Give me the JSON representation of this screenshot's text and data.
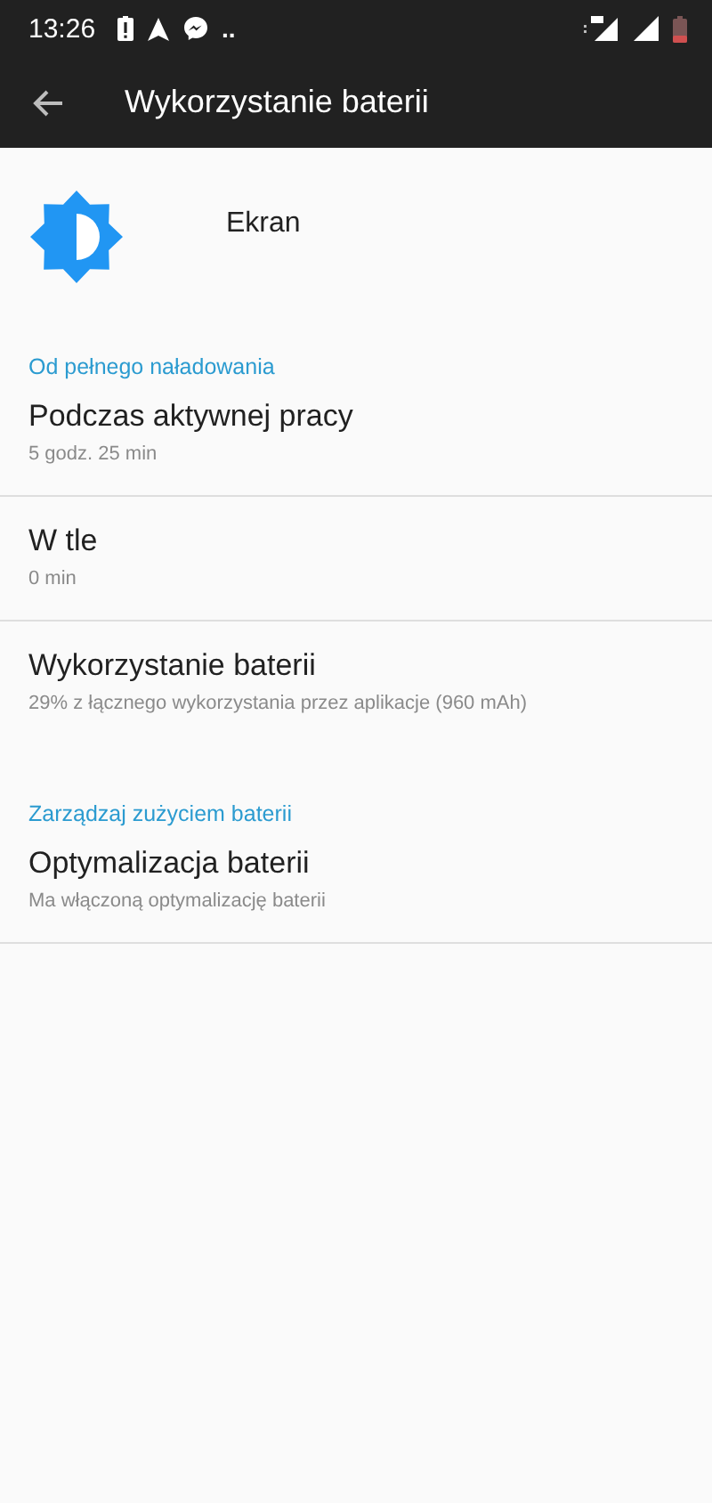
{
  "status_bar": {
    "time": "13:26",
    "dots": ".."
  },
  "toolbar": {
    "title": "Wykorzystanie baterii"
  },
  "app": {
    "name": "Ekran"
  },
  "sections": [
    {
      "title": "Od pełnego naładowania",
      "items": [
        {
          "title": "Podczas aktywnej pracy",
          "subtitle": "5 godz. 25 min"
        },
        {
          "title": "W tle",
          "subtitle": "0 min"
        },
        {
          "title": "Wykorzystanie baterii",
          "subtitle": "29% z łącznego wykorzystania przez aplikacje (960 mAh)"
        }
      ]
    },
    {
      "title": "Zarządzaj zużyciem baterii",
      "items": [
        {
          "title": "Optymalizacja baterii",
          "subtitle": "Ma włączoną optymalizację baterii"
        }
      ]
    }
  ]
}
